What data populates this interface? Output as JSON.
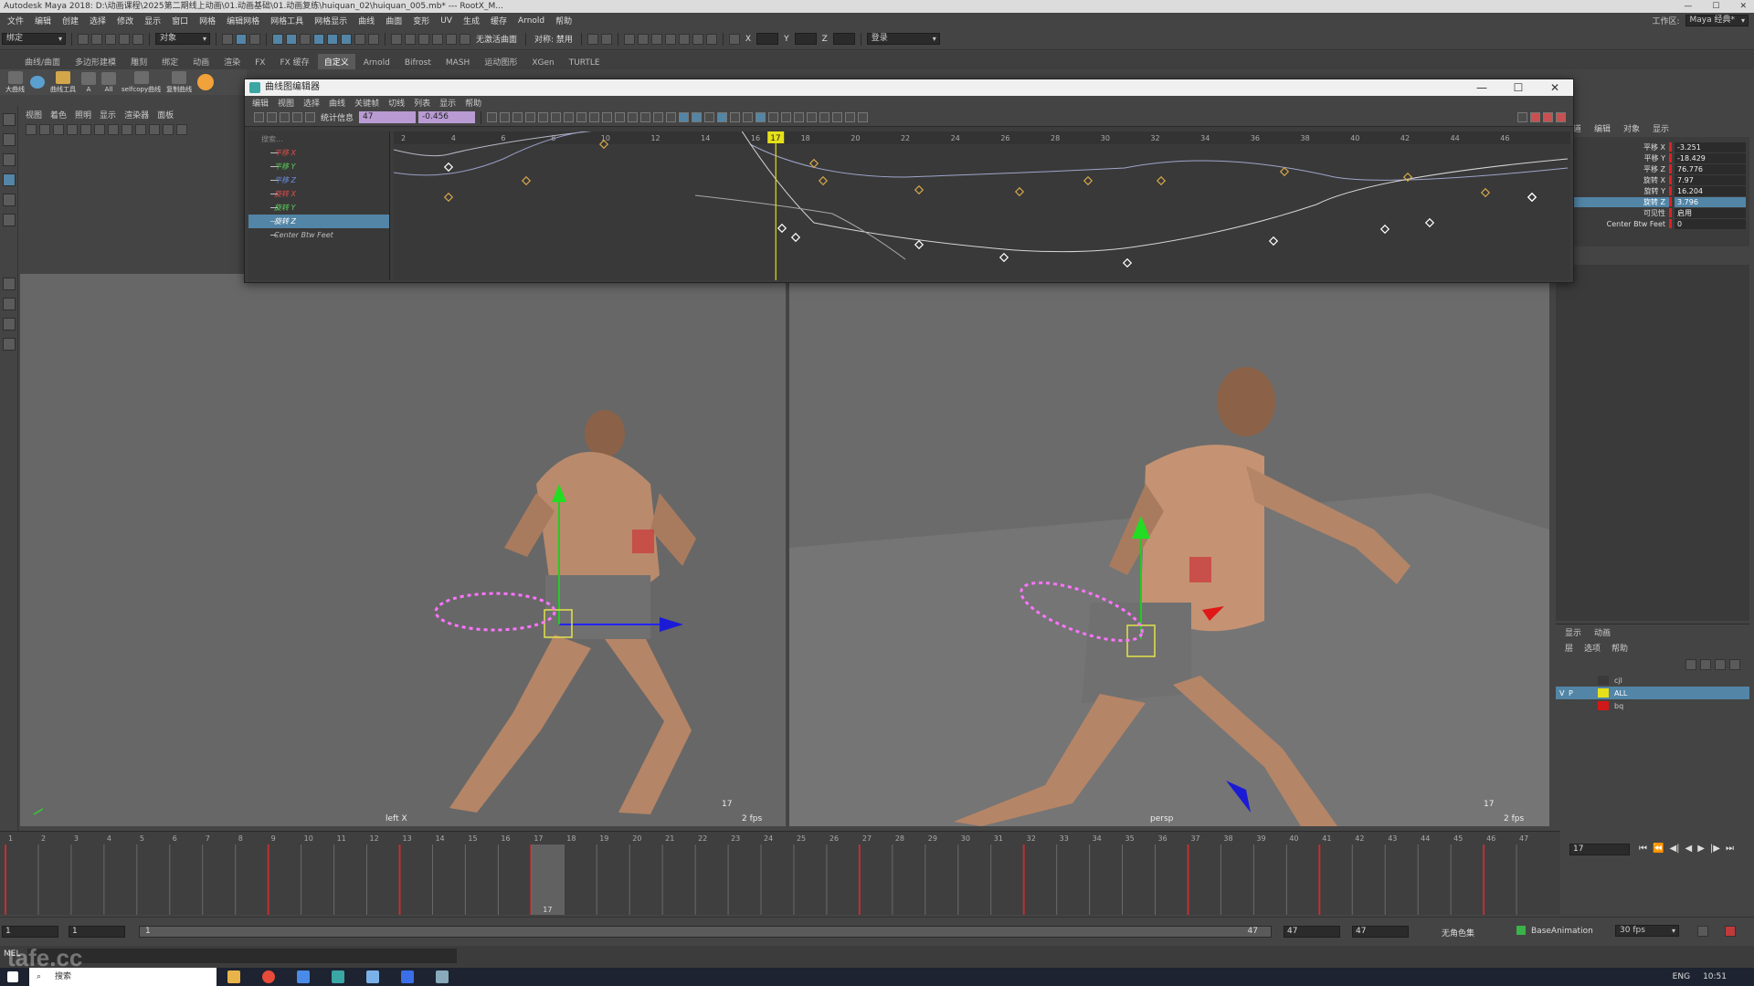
{
  "window": {
    "title": "Autodesk Maya 2018: D:\\动画课程\\2025第二期线上动画\\01.动画基础\\01.动画复练\\huiquan_02\\huiquan_005.mb* --- RootX_M...",
    "controls": [
      "—",
      "☐",
      "✕"
    ]
  },
  "menubar": {
    "items": [
      "文件",
      "编辑",
      "创建",
      "选择",
      "修改",
      "显示",
      "窗口",
      "网格",
      "编辑网格",
      "网格工具",
      "网格显示",
      "曲线",
      "曲面",
      "变形",
      "UV",
      "生成",
      "缓存",
      "Arnold",
      "帮助"
    ],
    "workspace_label": "工作区:",
    "workspace_value": "Maya 经典*"
  },
  "statusline": {
    "mode_menu": "绑定",
    "object_label": "对象",
    "no_live_surface": "无激活曲面",
    "symmetry": "对称: 禁用",
    "axis_x": "X",
    "axis_y": "Y",
    "axis_z": "Z",
    "login": "登录"
  },
  "shelf": {
    "tabs": [
      "曲线/曲面",
      "多边形建模",
      "雕刻",
      "绑定",
      "动画",
      "渲染",
      "FX",
      "FX 缓存",
      "自定义",
      "Arnold",
      "Bifrost",
      "MASH",
      "运动图形",
      "XGen",
      "TURTLE"
    ],
    "active_tab": "自定义",
    "buttons": [
      "大曲线",
      "",
      "曲线工具",
      "A",
      "All",
      "selfcopy曲线",
      "复制曲线"
    ]
  },
  "panel_menu": [
    "视图",
    "着色",
    "照明",
    "显示",
    "渲染器",
    "面板"
  ],
  "graph_editor": {
    "title": "曲线图编辑器",
    "menu": [
      "编辑",
      "视图",
      "选择",
      "曲线",
      "关键帧",
      "切线",
      "列表",
      "显示",
      "帮助"
    ],
    "stats_label": "统计信息",
    "frame_value": "47",
    "value_field": "-0.456",
    "search_placeholder": "搜索...",
    "outliner": [
      {
        "label": "平移 X",
        "color": "#e24b4b"
      },
      {
        "label": "平移 Y",
        "color": "#5ad05a"
      },
      {
        "label": "平移 Z",
        "color": "#6c8fe8"
      },
      {
        "label": "旋转 X",
        "color": "#e24b4b"
      },
      {
        "label": "旋转 Y",
        "color": "#5ad05a"
      },
      {
        "label": "旋转 Z",
        "color": "#cfe6ff"
      },
      {
        "label": "Center Btw Feet",
        "color": "#bbbbbb"
      }
    ],
    "selected_row": 5,
    "ruler_ticks": [
      "2",
      "4",
      "6",
      "8",
      "10",
      "12",
      "14",
      "16",
      "18",
      "20",
      "22",
      "24",
      "26",
      "28",
      "30",
      "32",
      "34",
      "36",
      "38",
      "40",
      "42",
      "44",
      "46"
    ],
    "current_frame": "17"
  },
  "channel_box": {
    "menu": [
      "通道",
      "编辑",
      "对象",
      "显示"
    ],
    "channels": [
      {
        "name": "平移 X",
        "value": "-3.251"
      },
      {
        "name": "平移 Y",
        "value": "-18.429"
      },
      {
        "name": "平移 Z",
        "value": "76.776"
      },
      {
        "name": "旋转 X",
        "value": "7.97"
      },
      {
        "name": "旋转 Y",
        "value": "16.204"
      },
      {
        "name": "旋转 Z",
        "value": "3.796"
      },
      {
        "name": "可见性",
        "value": "启用"
      },
      {
        "name": "Center Btw Feet",
        "value": "0"
      }
    ],
    "selected_channel": 5
  },
  "layer_editor": {
    "tabs": [
      "显示",
      "动画"
    ],
    "menu": [
      "层",
      "选项",
      "帮助"
    ],
    "layers": [
      {
        "vis": "",
        "ref": "",
        "name": "cjl",
        "color": "#3a3a3a"
      },
      {
        "vis": "V",
        "ref": "P",
        "name": "ALL",
        "color": "#e6e01a"
      },
      {
        "vis": "",
        "ref": "",
        "name": "bq",
        "color": "#d01919"
      }
    ],
    "selected_layer": 1
  },
  "viewports": {
    "left": {
      "camera": "left X",
      "frame": "17",
      "fps": "2 fps"
    },
    "right": {
      "camera": "persp",
      "frame": "17",
      "fps": "2 fps"
    }
  },
  "timeslider": {
    "ticks": [
      "1",
      "2",
      "3",
      "4",
      "5",
      "6",
      "7",
      "8",
      "9",
      "10",
      "11",
      "12",
      "13",
      "14",
      "15",
      "16",
      "17",
      "18",
      "19",
      "20",
      "21",
      "22",
      "23",
      "24",
      "25",
      "26",
      "27",
      "28",
      "29",
      "30",
      "31",
      "32",
      "33",
      "34",
      "35",
      "36",
      "37",
      "38",
      "39",
      "40",
      "41",
      "42",
      "43",
      "44",
      "45",
      "46",
      "47"
    ],
    "key_frames": [
      1,
      9,
      13,
      17,
      27,
      32,
      37,
      41,
      46
    ],
    "current_frame": "17",
    "current_field": "17"
  },
  "range": {
    "start": "1",
    "anim_start": "1",
    "range_start": "1",
    "range_end": "47",
    "anim_end": "47",
    "end": "47",
    "character_set": "无角色集",
    "anim_layer": "BaseAnimation",
    "fps": "30 fps"
  },
  "cmdline": {
    "label": "MEL"
  },
  "watermark": "tafe.cc",
  "taskbar": {
    "search": "搜索",
    "lang": "ENG",
    "time": "10:51"
  }
}
